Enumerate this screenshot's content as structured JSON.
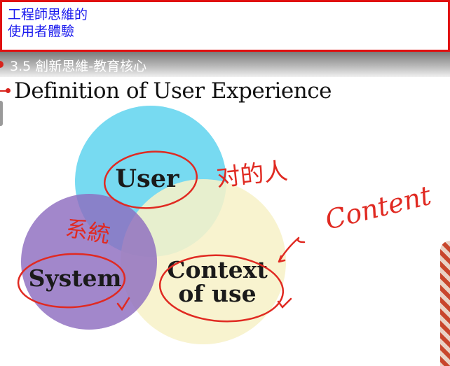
{
  "note": {
    "line1": "工程師思維的",
    "line2": "使用者體驗"
  },
  "video": {
    "chapter_title": "3.5 創新思維-教育核心",
    "slide_title": "Definition of User Experience",
    "circles": {
      "user": "User",
      "system": "System",
      "context_line1": "Context",
      "context_line2": "of use"
    },
    "handwriting": {
      "user_note": "对的人",
      "system_note": "系統",
      "context_note": "Content"
    },
    "colors": {
      "user_circle": "#5fd3ee",
      "system_circle": "#8e6dc0",
      "context_circle": "#f7f1c8",
      "ink": "#e02a22",
      "note_text": "#1a1aee",
      "note_border": "#e01010"
    }
  }
}
